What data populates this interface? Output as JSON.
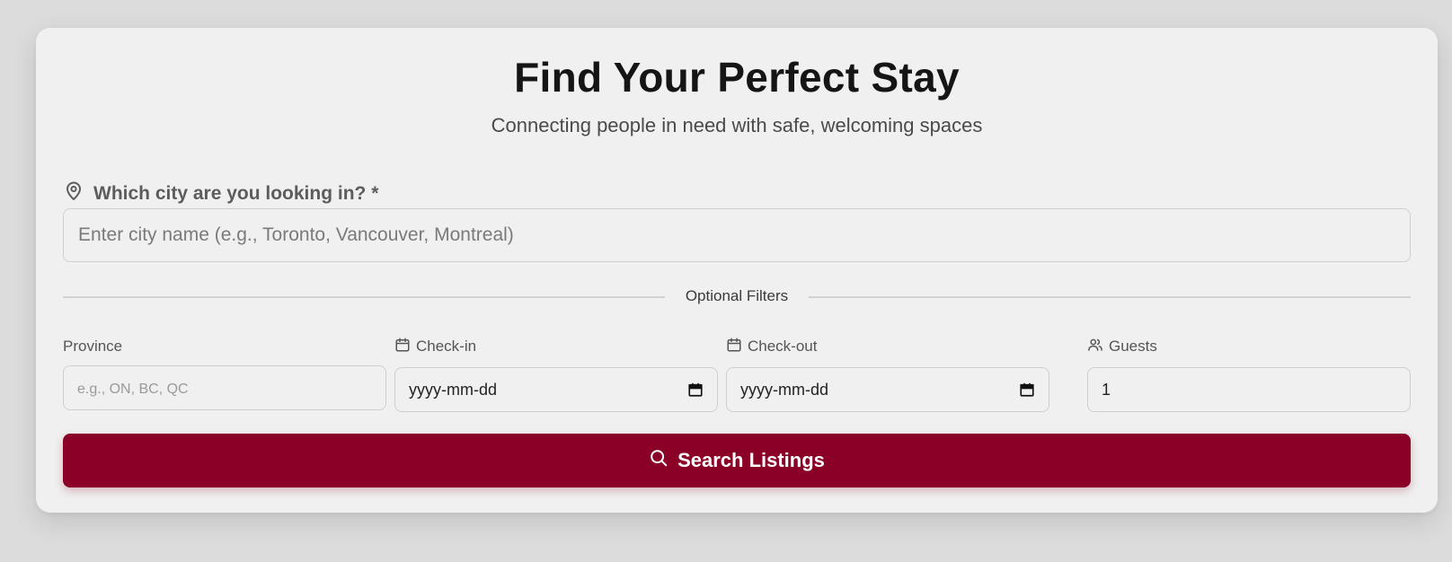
{
  "header": {
    "title": "Find Your Perfect Stay",
    "subtitle": "Connecting people in need with safe, welcoming spaces"
  },
  "city": {
    "icon": "map-pin-icon",
    "label": "Which city are you looking in? *",
    "placeholder": "Enter city name (e.g., Toronto, Vancouver, Montreal)",
    "value": ""
  },
  "filters": {
    "divider_label": "Optional Filters",
    "province": {
      "label": "Province",
      "placeholder": "e.g., ON, BC, QC",
      "value": ""
    },
    "check_in": {
      "icon": "calendar-icon",
      "label": "Check-in",
      "value": "yyyy-mm-dd",
      "picker_icon": "calendar-picker-icon"
    },
    "check_out": {
      "icon": "calendar-icon",
      "label": "Check-out",
      "value": "yyyy-mm-dd",
      "picker_icon": "calendar-picker-icon"
    },
    "guests": {
      "icon": "users-icon",
      "label": "Guests",
      "value": "1"
    }
  },
  "search_button": {
    "icon": "search-icon",
    "label": "Search Listings"
  },
  "colors": {
    "accent": "#8b0026",
    "card_background": "#f0f0f0",
    "page_background": "#dcdcdc"
  }
}
